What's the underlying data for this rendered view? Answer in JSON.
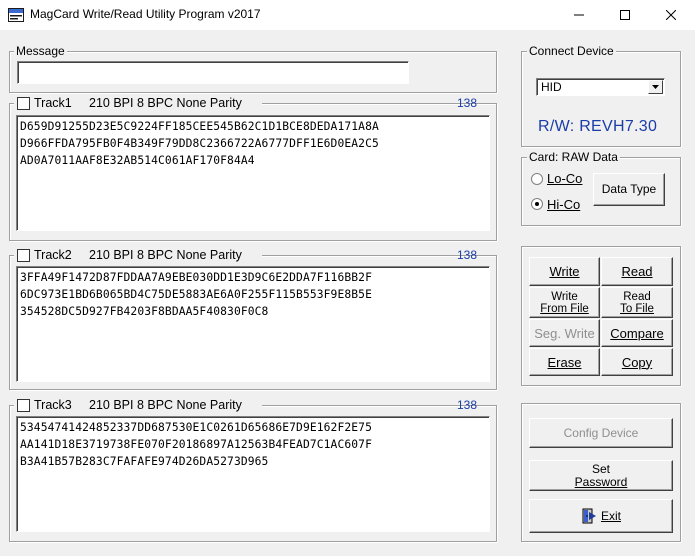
{
  "window": {
    "title": "MagCard Write/Read Utility Program  v2017"
  },
  "message": {
    "label": "Message",
    "value": ""
  },
  "tracks": [
    {
      "name": "Track1",
      "info": "210 BPI  8 BPC  None Parity",
      "count": "138",
      "checked": false,
      "data": "D659D91255D23E5C9224FF185CEE545B62C1D1BCE8DEDA171A8A\nD966FFDA795FB0F4B349F79DD8C2366722A6777DFF1E6D0EA2C5\nAD0A7011AAF8E32AB514C061AF170F84A4"
    },
    {
      "name": "Track2",
      "info": "210 BPI  8 BPC  None Parity",
      "count": "138",
      "checked": false,
      "data": "3FFA49F1472D87FDDAA7A9EBE030DD1E3D9C6E2DDA7F116BB2F\n6DC973E1BD6B065BD4C75DE5883AE6A0F255F115B553F9E8B5E\n354528DC5D927FB4203F8BDAA5F40830F0C8"
    },
    {
      "name": "Track3",
      "info": "210 BPI  8 BPC  None Parity",
      "count": "138",
      "checked": false,
      "data": "53454741424852337DD687530E1C0261D65686E7D9E162F2E75\nAA141D18E3719738FE070F20186897A12563B4FEAD7C1AC607F\nB3A41B57B283C7FAFAFE974D26DA5273D965"
    }
  ],
  "connect": {
    "label": "Connect Device",
    "device_selected": "HID",
    "version": "R/W:  REVH7.30"
  },
  "card": {
    "label": "Card: RAW Data",
    "loco": "Lo-Co",
    "hico": "Hi-Co",
    "selected": "Hi-Co",
    "data_type_button": "Data Type"
  },
  "actions": {
    "write": "Write",
    "read": "Read",
    "write_file_1": "Write",
    "write_file_2": "From File",
    "read_file_1": "Read",
    "read_file_2": "To File",
    "seg_write": "Seg. Write",
    "compare": "Compare",
    "erase": "Erase",
    "copy": "Copy"
  },
  "bottom": {
    "config_device": "Config Device",
    "set_password_1": "Set",
    "set_password_2": "Password",
    "exit": "Exit"
  },
  "colors": {
    "accent_blue": "#1a3da8",
    "background": "#f0f0f0"
  }
}
